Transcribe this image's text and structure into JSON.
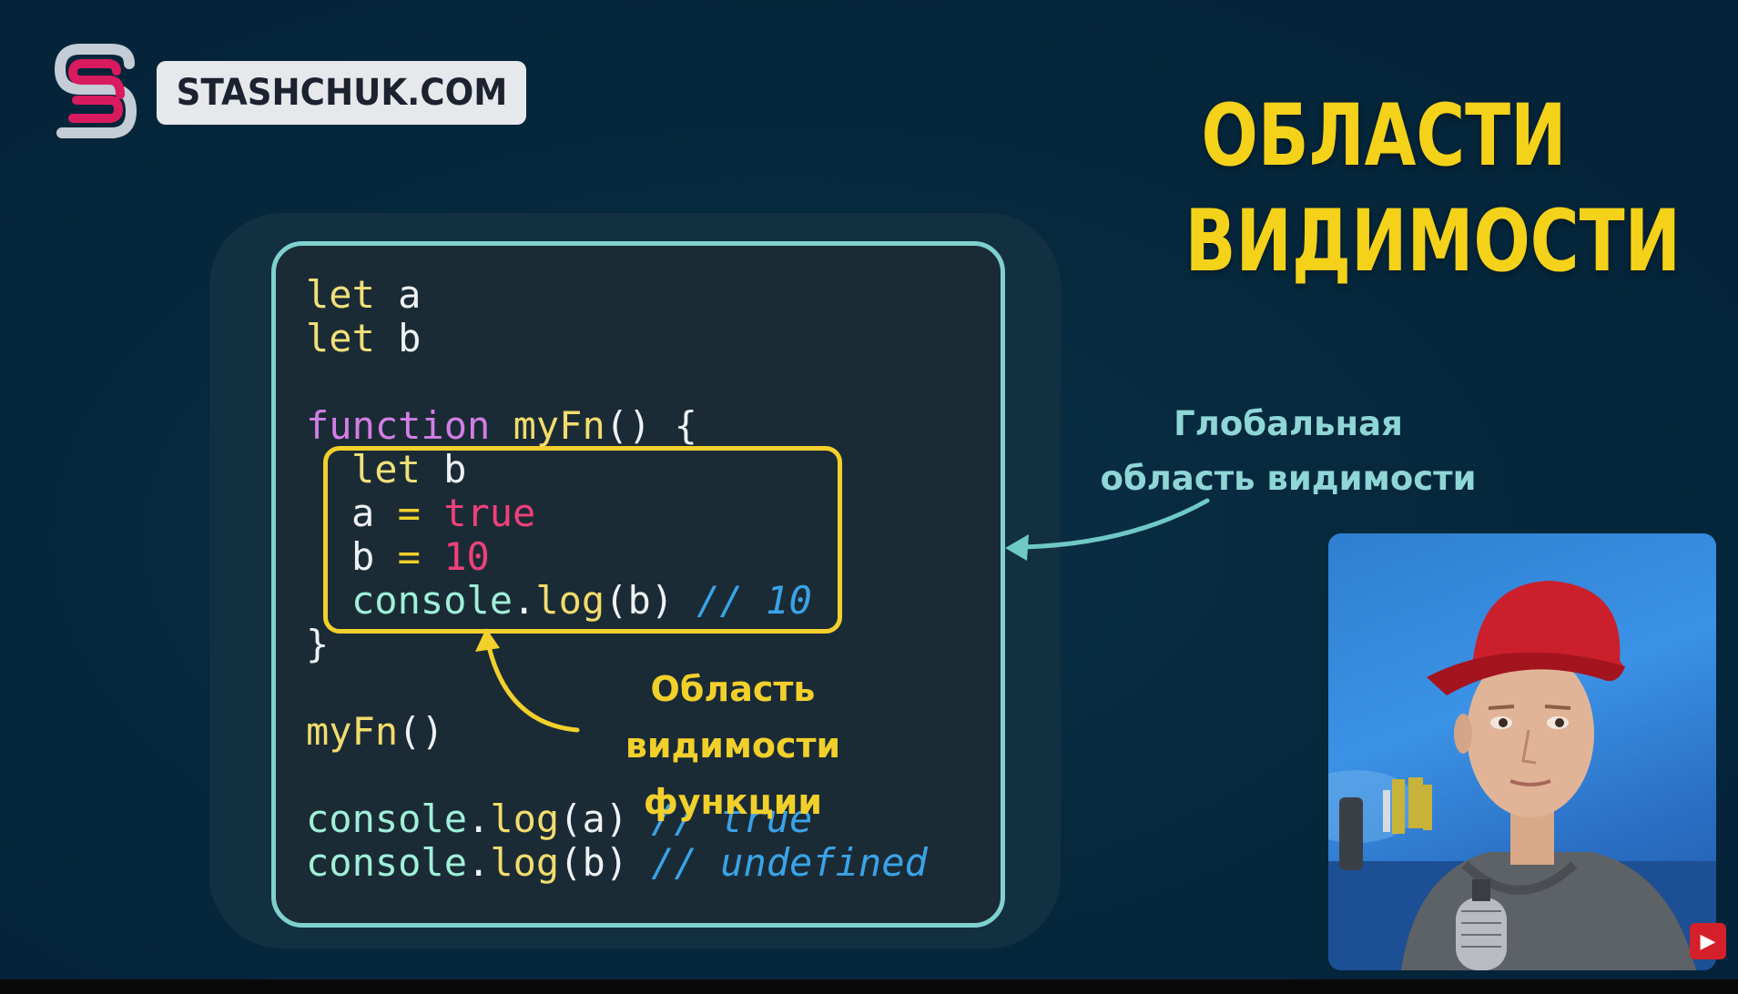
{
  "logo": {
    "text": "STASHCHUK.COM",
    "icon": "stashchuk-s-logo-icon"
  },
  "title": {
    "line1": "ОБЛАСТИ",
    "line2": "ВИДИМОСТИ"
  },
  "code": {
    "line1_kw": "let",
    "line1_var": "a",
    "line2_kw": "let",
    "line2_var": "b",
    "line4_kw": "function",
    "line4_name": "myFn",
    "line4_rest": "() {",
    "line5_kw": "let",
    "line5_var": "b",
    "line6_var": "a",
    "line6_op": "=",
    "line6_val": "true",
    "line7_var": "b",
    "line7_op": "=",
    "line7_val": "10",
    "line8_obj": "console",
    "line8_dot": ".",
    "line8_method": "log",
    "line8_args": "(b)",
    "line8_comment": "// 10",
    "line9": "}",
    "line11_name": "myFn",
    "line11_rest": "()",
    "line13_obj": "console",
    "line13_dot": ".",
    "line13_method": "log",
    "line13_args": "(a)",
    "line13_comment": "// true",
    "line14_obj": "console",
    "line14_dot": ".",
    "line14_method": "log",
    "line14_args": "(b)",
    "line14_comment": "// undefined"
  },
  "annotations": {
    "global_line1": "Глобальная",
    "global_line2": "область видимости",
    "function_line1": "Область видимости",
    "function_line2": "функции"
  },
  "colors": {
    "background": "#06273b",
    "title": "#f4d21a",
    "global_scope_border": "#7fd1cf",
    "function_scope_border": "#f2d02c",
    "comment": "#3aa3e8",
    "keyword_let": "#f0e07a",
    "keyword_function": "#d27ee6",
    "literal": "#f0407a"
  },
  "presenter": {
    "icon": "presenter-video-feed",
    "subscribe_icon": "youtube-subscribe-icon"
  }
}
